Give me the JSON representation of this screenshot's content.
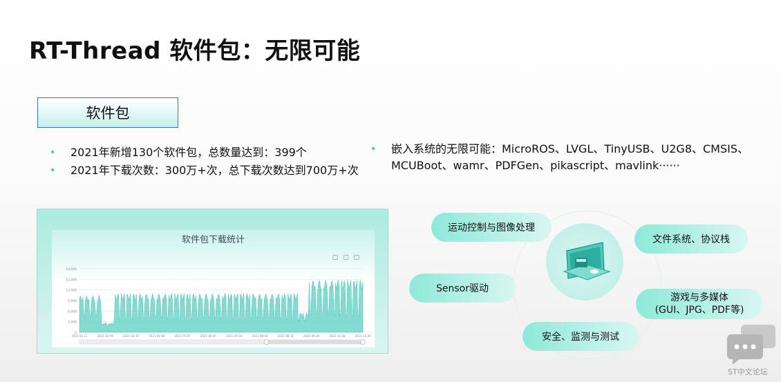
{
  "title": "RT-Thread 软件包：无限可能",
  "section_label": "软件包",
  "left_bullets": [
    "2021年新增130个软件包，总数量达到：399个",
    "2021年下载次数：300万+次，总下载次数达到700万+次"
  ],
  "right_bullets": [
    "嵌入系统的无限可能：MicroROS、LVGL、TinyUSB、U2G8、CMSIS、",
    "MCUBoot、wamr、PDFGen、pikascript、mavlink······"
  ],
  "bullet_symbol": "•",
  "chart": {
    "title": "软件包下载统计",
    "toolbar": "▢ ▢ ▢",
    "y_ticks": [
      "18,000",
      "15,000",
      "12,000",
      "9,000",
      "6,000",
      "3,000",
      "0"
    ],
    "x_ticks": [
      "2021-01-11",
      "2021-02-09",
      "2021-03-10",
      "2021-04-08",
      "2021-05-07",
      "2021-06-05",
      "2021-07-04",
      "2021-08-02",
      "2021-08-31",
      "2021-09-29",
      "2021-10-28",
      "2021-11-26"
    ]
  },
  "chart_data": {
    "type": "area",
    "title": "软件包下载统计",
    "xlabel": "",
    "ylabel": "",
    "ylim": [
      0,
      18000
    ],
    "x_range": [
      "2021-01-11",
      "2021-12-10"
    ],
    "weekly_pattern_peak": [
      9500,
      9800,
      9600,
      4500,
      3000
    ],
    "segments": [
      {
        "from": "2021-01-11",
        "to": "2021-02-05",
        "weekday": 9500,
        "weekend": 4500
      },
      {
        "from": "2021-02-06",
        "to": "2021-02-20",
        "weekday": 2500,
        "weekend": 2000
      },
      {
        "from": "2021-02-21",
        "to": "2021-09-25",
        "weekday": 10000,
        "weekend": 4000
      },
      {
        "from": "2021-09-26",
        "to": "2021-10-07",
        "weekday": 5000,
        "weekend": 3500
      },
      {
        "from": "2021-10-08",
        "to": "2021-12-10",
        "weekday": 13500,
        "weekend": 5000
      }
    ],
    "grid": true
  },
  "features": [
    "运动控制与图像处理",
    "文件系统、协议栈",
    "Sensor驱动",
    "游戏与多媒体",
    "(GUI、JPG、PDF等)",
    "安全、监测与测试"
  ],
  "watermark": "ST中文论坛",
  "colors": {
    "accent": "#3cc9b5",
    "bubble": "#8ee8d8",
    "area": "#5ccdc2"
  }
}
